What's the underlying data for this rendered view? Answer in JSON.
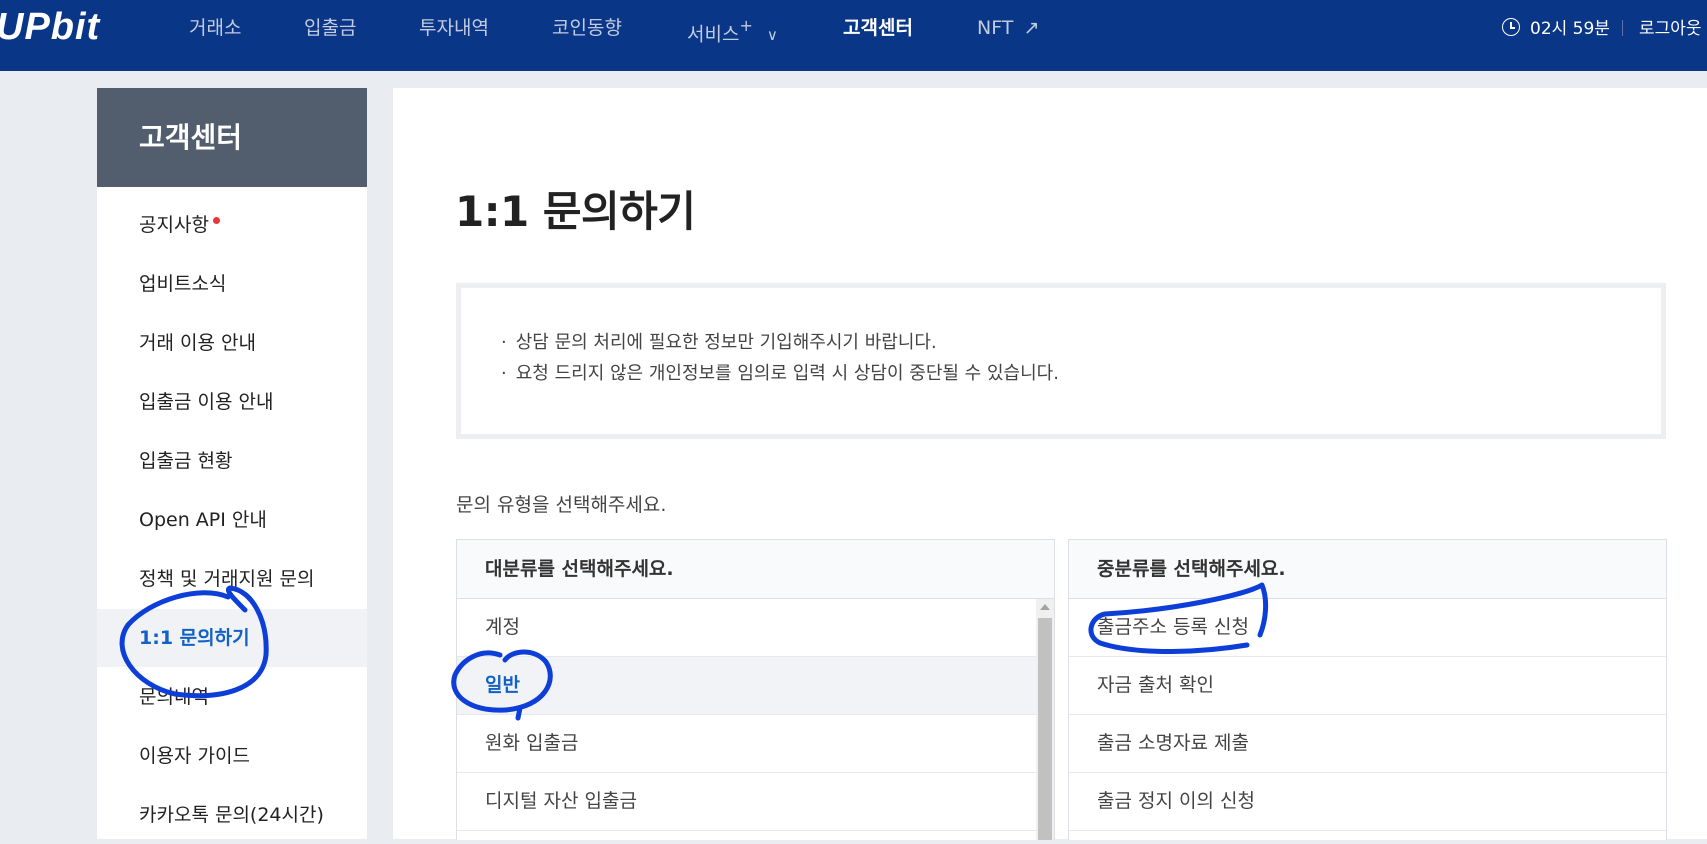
{
  "header": {
    "logo": "UPbit",
    "nav": [
      {
        "label": "거래소"
      },
      {
        "label": "입출금"
      },
      {
        "label": "투자내역"
      },
      {
        "label": "코인동향"
      },
      {
        "label": "서비스",
        "suffix": "+",
        "chevron": "∨"
      },
      {
        "label": "고객센터",
        "active": true
      },
      {
        "label": "NFT",
        "arrow": "↗"
      }
    ],
    "session_time": "02시 59분",
    "logout_label": "로그아웃"
  },
  "sidebar": {
    "title": "고객센터",
    "items": [
      {
        "label": "공지사항",
        "has_badge": true
      },
      {
        "label": "업비트소식"
      },
      {
        "label": "거래 이용 안내"
      },
      {
        "label": "입출금 이용 안내"
      },
      {
        "label": "입출금 현황"
      },
      {
        "label": "Open API 안내"
      },
      {
        "label": "정책 및 거래지원 문의"
      },
      {
        "label": "1:1 문의하기",
        "active": true
      },
      {
        "label": "문의내역"
      },
      {
        "label": "이용자 가이드"
      },
      {
        "label": "카카오톡 문의(24시간)"
      }
    ]
  },
  "main": {
    "title": "1:1 문의하기",
    "notices": [
      "상담 문의 처리에 필요한 정보만 기입해주시기 바랍니다.",
      "요청 드리지 않은 개인정보를 임의로 입력 시 상담이 중단될 수 있습니다."
    ],
    "type_prompt": "문의 유형을 선택해주세요.",
    "major": {
      "header": "대분류를 선택해주세요.",
      "options": [
        "계정",
        "일반",
        "원화 입출금",
        "디지털 자산 입출금"
      ],
      "selected": "일반"
    },
    "minor": {
      "header": "중분류를 선택해주세요.",
      "options": [
        "출금주소 등록 신청",
        "자금 출처 확인",
        "출금 소명자료 제출",
        "출금 정지 이의 신청"
      ]
    }
  },
  "colors": {
    "header_bg": "#093687",
    "sidebar_head_bg": "#525e6e",
    "accent_blue": "#1261c4",
    "annotation_ink": "#0d3fd8",
    "badge_red": "#e9363c"
  }
}
